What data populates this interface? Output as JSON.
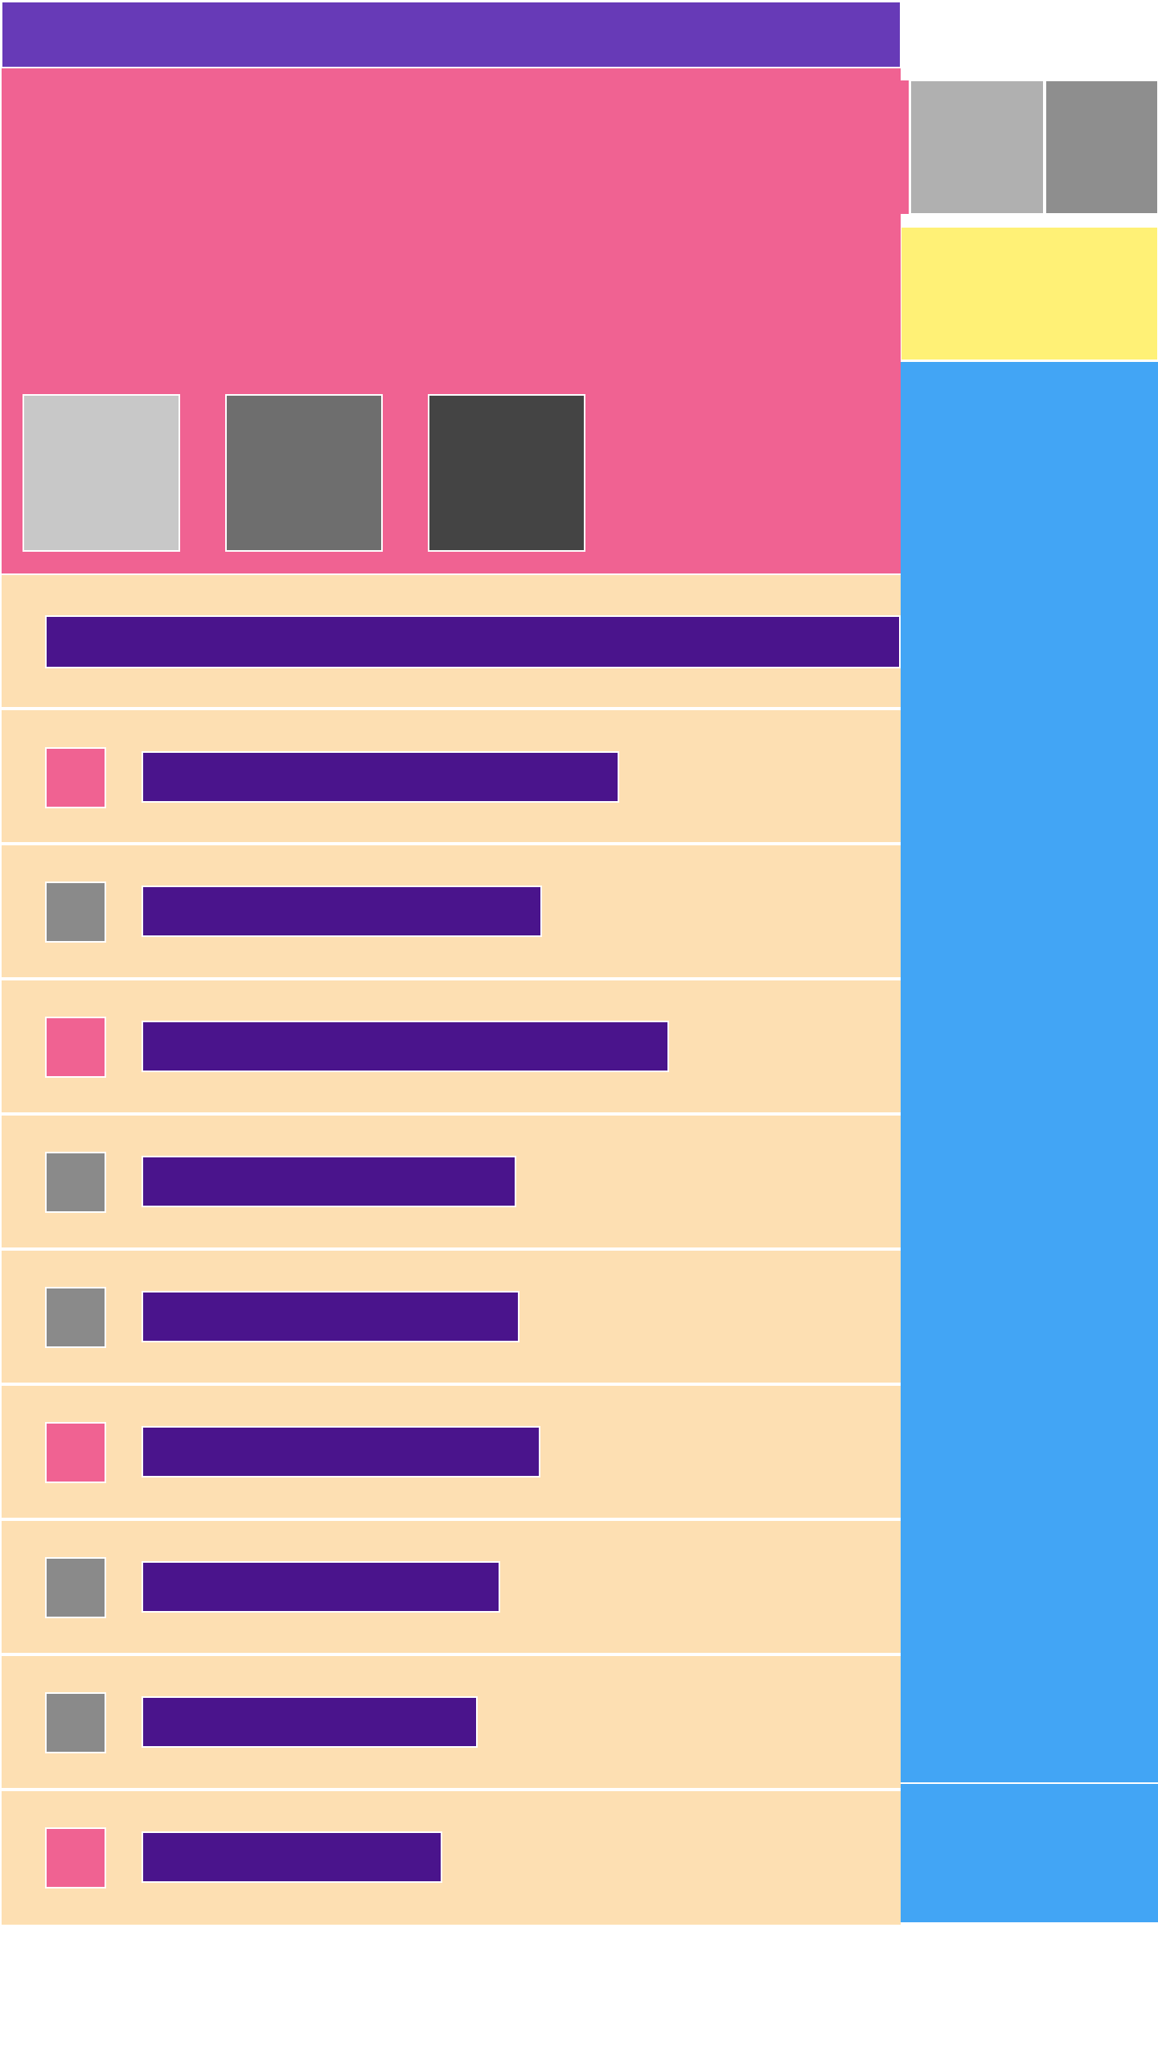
{
  "colors": {
    "accent_purple": "#673AB7",
    "deep_purple": "#4A148C",
    "pink": "#F06292",
    "peach": "#FDDFB2",
    "yellow": "#FFF176",
    "blue": "#42A5F5",
    "gray_light": "#C8C8C8",
    "gray_mid": "#6E6E6E",
    "gray_dark": "#444444",
    "gray_row": "#8A8A8A"
  },
  "hero": {
    "thumbnails": [
      {
        "color": "#C8C8C8"
      },
      {
        "color": "#6E6E6E"
      },
      {
        "color": "#444444"
      }
    ]
  },
  "list": {
    "rows": [
      {
        "icon_color": "#F06292"
      },
      {
        "icon_color": "#8A8A8A"
      },
      {
        "icon_color": "#F06292"
      },
      {
        "icon_color": "#8A8A8A"
      },
      {
        "icon_color": "#8A8A8A"
      },
      {
        "icon_color": "#F06292"
      },
      {
        "icon_color": "#8A8A8A"
      },
      {
        "icon_color": "#8A8A8A"
      },
      {
        "icon_color": "#F06292"
      }
    ]
  }
}
